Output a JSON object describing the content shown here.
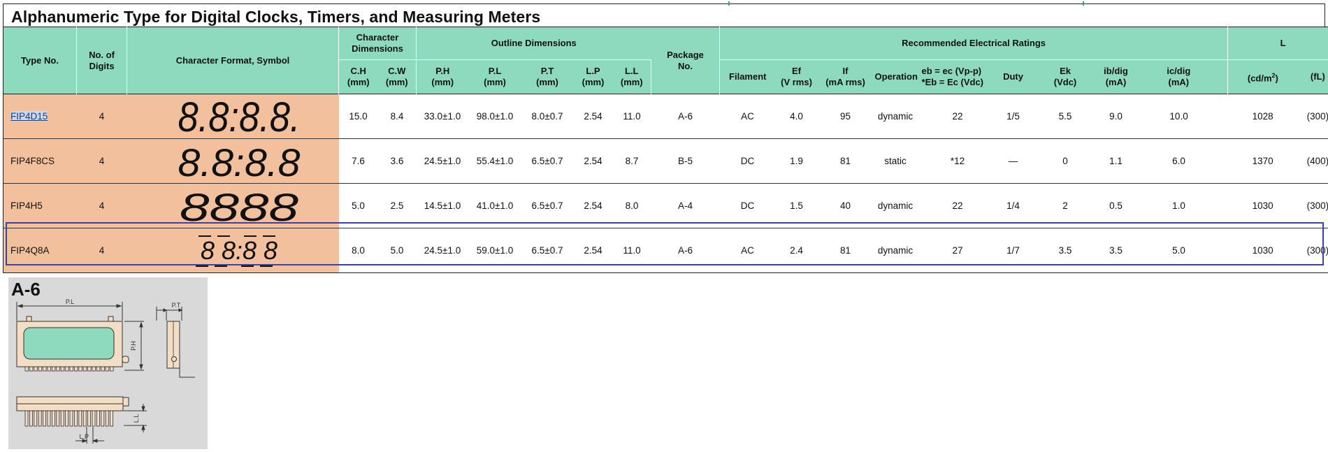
{
  "title": "Alphanumeric Type for Digital Clocks, Timers, and Measuring Meters",
  "headers": {
    "type_no": "Type No.",
    "no_of_digits_1": "No. of",
    "no_of_digits_2": "Digits",
    "char_format": "Character Format, Symbol",
    "char_dimensions_1": "Character",
    "char_dimensions_2": "Dimensions",
    "outline_dimensions": "Outline Dimensions",
    "package_no_1": "Package",
    "package_no_2": "No.",
    "recommended": "Recommended Electrical Ratings",
    "luminance": "L",
    "ch_1": "C.H",
    "ch_2": "(mm)",
    "cw_1": "C.W",
    "cw_2": "(mm)",
    "ph_1": "P.H",
    "ph_2": "(mm)",
    "pl_1": "P.L",
    "pl_2": "(mm)",
    "pt_1": "P.T",
    "pt_2": "(mm)",
    "lp_1": "L.P",
    "lp_2": "(mm)",
    "ll_1": "L.L",
    "ll_2": "(mm)",
    "filament": "Filament",
    "ef_1": "Ef",
    "ef_2": "(V rms)",
    "if_1": "If",
    "if_2": "(mA rms)",
    "operation": "Operation",
    "eb_1": "eb = ec (Vp-p)",
    "eb_2": "*Eb = Ec (Vdc)",
    "duty": "Duty",
    "ek_1": "Ek",
    "ek_2": "(Vdc)",
    "ib_1": "ib/dig",
    "ib_2": "(mA)",
    "ic_1": "ic/dig",
    "ic_2": "(mA)",
    "cdm2_base": "(cd/m",
    "cdm2_sup": "2",
    "cdm2_end": ")",
    "fl": "(fL)"
  },
  "rows": [
    {
      "type": "FIP4D15",
      "digits": "4",
      "symbol": "8.8:8.8.",
      "ch": "15.0",
      "cw": "8.4",
      "ph": "33.0±1.0",
      "pl": "98.0±1.0",
      "pt": "8.0±0.7",
      "lp": "2.54",
      "ll": "11.0",
      "pkg": "A-6",
      "filament": "AC",
      "ef": "4.0",
      "if": "95",
      "operation": "dynamic",
      "eb": "22",
      "duty": "1/5",
      "ek": "5.5",
      "ib": "9.0",
      "ic": "10.0",
      "cd": "1028",
      "fl": "(300)"
    },
    {
      "type": "FIP4F8CS",
      "digits": "4",
      "symbol": "8.8:8.8",
      "ch": "7.6",
      "cw": "3.6",
      "ph": "24.5±1.0",
      "pl": "55.4±1.0",
      "pt": "6.5±0.7",
      "lp": "2.54",
      "ll": "8.7",
      "pkg": "B-5",
      "filament": "DC",
      "ef": "1.9",
      "if": "81",
      "operation": "static",
      "eb": "*12",
      "duty": "—",
      "ek": "0",
      "ib": "1.1",
      "ic": "6.0",
      "cd": "1370",
      "fl": "(400)"
    },
    {
      "type": "FIP4H5",
      "digits": "4",
      "symbol": "8888",
      "ch": "5.0",
      "cw": "2.5",
      "ph": "14.5±1.0",
      "pl": "41.0±1.0",
      "pt": "6.5±0.7",
      "lp": "2.54",
      "ll": "8.0",
      "pkg": "A-4",
      "filament": "DC",
      "ef": "1.5",
      "if": "40",
      "operation": "dynamic",
      "eb": "22",
      "duty": "1/4",
      "ek": "2",
      "ib": "0.5",
      "ic": "1.0",
      "cd": "1030",
      "fl": "(300)"
    },
    {
      "type": "FIP4Q8A",
      "digits": "4",
      "symbol": "8 8:8 8",
      "ch": "8.0",
      "cw": "5.0",
      "ph": "24.5±1.0",
      "pl": "59.0±1.0",
      "pt": "6.5±0.7",
      "lp": "2.54",
      "ll": "11.0",
      "pkg": "A-6",
      "filament": "AC",
      "ef": "2.4",
      "if": "81",
      "operation": "dynamic",
      "eb": "27",
      "duty": "1/7",
      "ek": "3.5",
      "ib": "3.5",
      "ic": "5.0",
      "cd": "1030",
      "fl": "(300)"
    }
  ],
  "package_drawing": {
    "label": "A-6",
    "dim_pl": "P.L",
    "dim_pt": "P.T",
    "dim_ph": "P.H",
    "dim_ll": "L.L",
    "dim_lp": "L.P"
  },
  "colors": {
    "header_bg": "#8ddabf",
    "symbol_bg": "#f2c09c",
    "selection_border": "#3a44a8",
    "panel_bg": "#d9d9d9"
  }
}
